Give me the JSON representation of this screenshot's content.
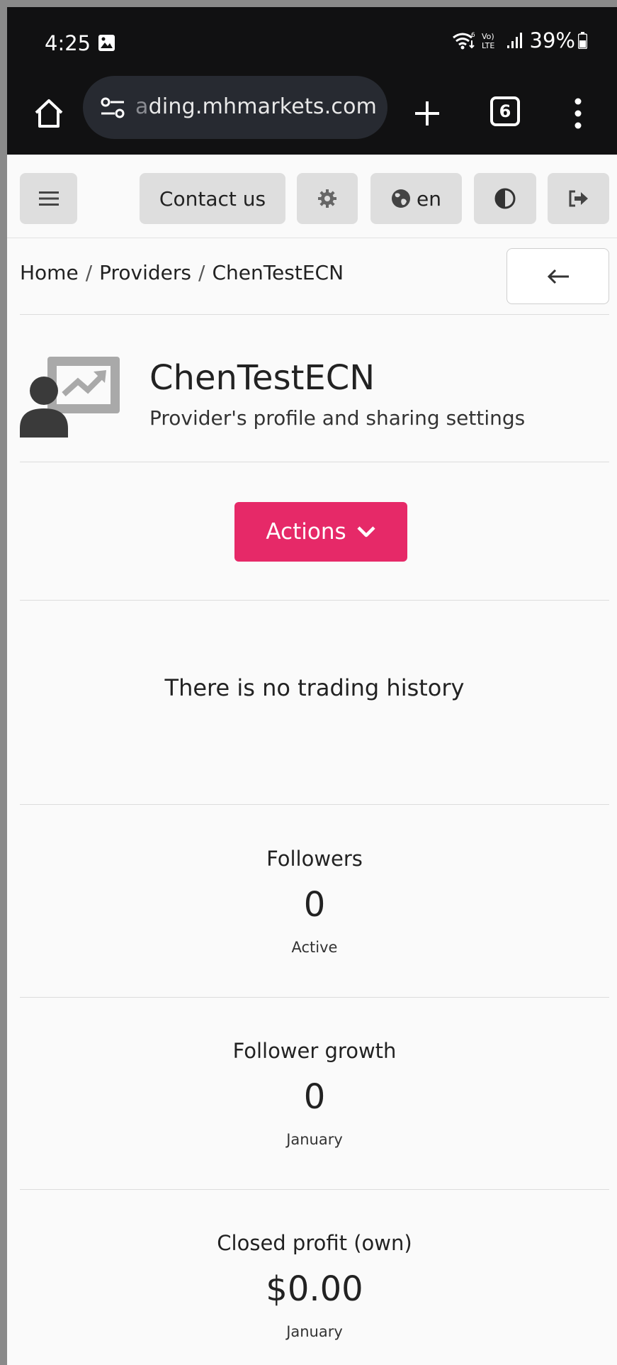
{
  "status_bar": {
    "time": "4:25",
    "network_label": "Vo) LTE",
    "battery": "39%"
  },
  "browser": {
    "url_fade": "a",
    "url": "ding.mhmarkets.com",
    "tab_count": "6"
  },
  "navbar": {
    "contact_label": "Contact us",
    "lang_label": "en"
  },
  "breadcrumb": {
    "items": [
      "Home",
      "Providers",
      "ChenTestECN"
    ],
    "separator": "/"
  },
  "provider": {
    "name": "ChenTestECN",
    "subtitle": "Provider's profile and sharing settings"
  },
  "actions": {
    "label": "Actions"
  },
  "history": {
    "empty_text": "There is no trading history"
  },
  "stats": [
    {
      "title": "Followers",
      "value": "0",
      "caption": "Active"
    },
    {
      "title": "Follower growth",
      "value": "0",
      "caption": "January"
    },
    {
      "title": "Closed profit (own)",
      "value": "$0.00",
      "caption": "January"
    }
  ],
  "colors": {
    "accent": "#e62968",
    "chrome_bg": "#111112",
    "button_bg": "#dedede"
  },
  "icons": {
    "home": "home-icon",
    "tune": "tune-icon",
    "plus": "plus-icon",
    "more": "more-vert-icon",
    "hamburger": "hamburger-icon",
    "settings": "gear-icon",
    "globe": "globe-icon",
    "theme": "contrast-icon",
    "logout": "logout-icon",
    "back": "arrow-left-icon",
    "provider": "presenter-chart-icon",
    "chevron": "chevron-down-icon"
  }
}
